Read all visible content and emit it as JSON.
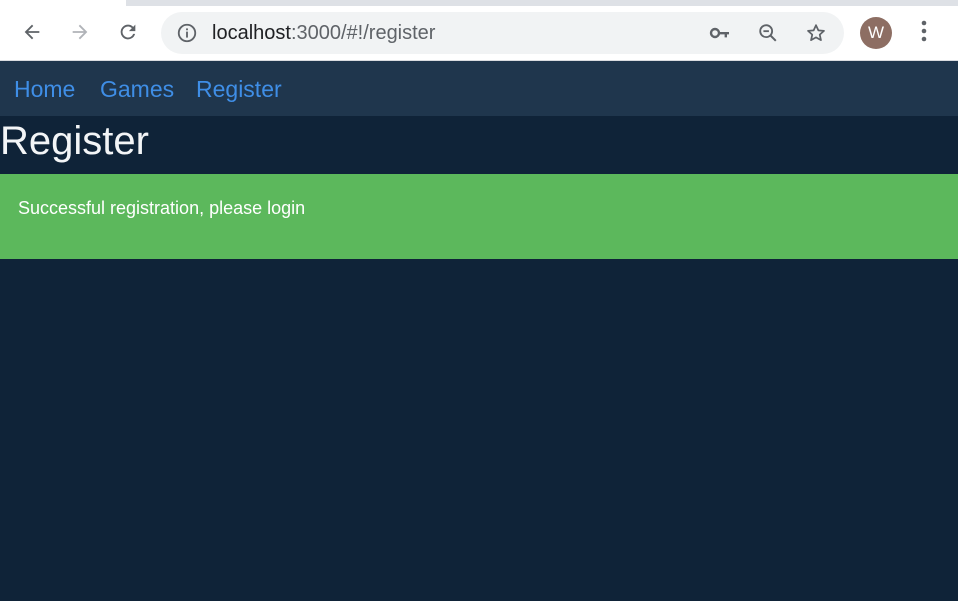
{
  "browser": {
    "url_host": "localhost",
    "url_rest": ":3000/#!/register",
    "profile_initial": "W",
    "icons": {
      "back": "arrow-left-icon",
      "forward": "arrow-right-icon",
      "reload": "reload-icon",
      "site_info": "info-icon",
      "password": "key-icon",
      "zoom": "zoom-out-icon",
      "bookmark": "star-icon",
      "menu": "kebab-menu-icon"
    }
  },
  "nav": {
    "home": "Home",
    "games": "Games",
    "register": "Register"
  },
  "page": {
    "title": "Register"
  },
  "alert": {
    "message": "Successful registration, please login"
  },
  "colors": {
    "page_background": "#0f2338",
    "navbar_background": "#1f364d",
    "link": "#3f8ee6",
    "alert_success": "#5cb85c",
    "title_text": "#f3f5f7"
  }
}
